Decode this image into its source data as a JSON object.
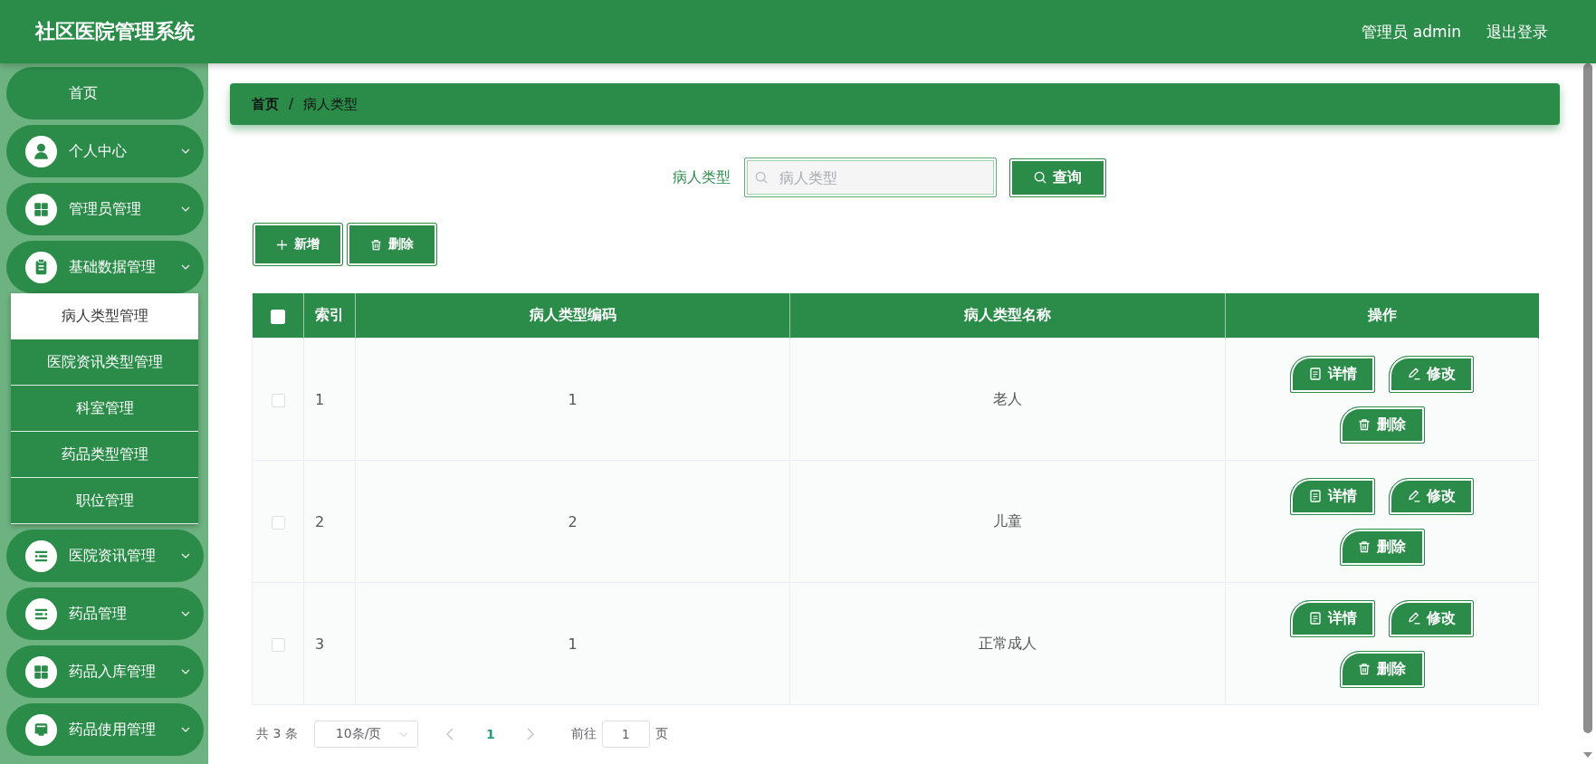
{
  "header": {
    "title": "社区医院管理系统",
    "user": "管理员 admin",
    "logout": "退出登录"
  },
  "sidebar": {
    "items": [
      {
        "kind": "link",
        "label": "首页"
      },
      {
        "kind": "group",
        "label": "个人中心",
        "expanded": false
      },
      {
        "kind": "group",
        "label": "管理员管理",
        "expanded": false
      },
      {
        "kind": "group",
        "label": "基础数据管理",
        "expanded": true,
        "children": [
          {
            "label": "病人类型管理",
            "selected": true
          },
          {
            "label": "医院资讯类型管理",
            "selected": false
          },
          {
            "label": "科室管理",
            "selected": false
          },
          {
            "label": "药品类型管理",
            "selected": false
          },
          {
            "label": "职位管理",
            "selected": false
          }
        ]
      },
      {
        "kind": "group",
        "label": "医院资讯管理",
        "expanded": false
      },
      {
        "kind": "group",
        "label": "药品管理",
        "expanded": false
      },
      {
        "kind": "group",
        "label": "药品入库管理",
        "expanded": false
      },
      {
        "kind": "group",
        "label": "药品使用管理",
        "expanded": false
      }
    ]
  },
  "breadcrumb": {
    "items": [
      "首页",
      "病人类型"
    ],
    "separator": "/"
  },
  "search": {
    "label": "病人类型",
    "placeholder": "病人类型",
    "button": "查询"
  },
  "toolbar": [
    {
      "kind": "add",
      "label": "新增"
    },
    {
      "kind": "delete",
      "label": "删除"
    }
  ],
  "table": {
    "select_all": {
      "checked": false
    },
    "columns": [
      "索引",
      "病人类型编码",
      "病人类型名称",
      "操作"
    ],
    "rows": [
      {
        "checked": false,
        "cells": [
          "1",
          "1",
          "老人"
        ],
        "actions": [
          {
            "kind": "detail",
            "label": "详情"
          },
          {
            "kind": "edit",
            "label": "修改"
          },
          {
            "kind": "delete",
            "label": "删除"
          }
        ]
      },
      {
        "checked": false,
        "cells": [
          "2",
          "2",
          "儿童"
        ],
        "actions": [
          {
            "kind": "detail",
            "label": "详情"
          },
          {
            "kind": "edit",
            "label": "修改"
          },
          {
            "kind": "delete",
            "label": "删除"
          }
        ]
      },
      {
        "checked": false,
        "cells": [
          "3",
          "1",
          "正常成人"
        ],
        "actions": [
          {
            "kind": "detail",
            "label": "详情"
          },
          {
            "kind": "edit",
            "label": "修改"
          },
          {
            "kind": "delete",
            "label": "删除"
          }
        ]
      }
    ]
  },
  "pagination": {
    "total": "共 3 条",
    "page_size": "10条/页",
    "prev": {
      "disabled": true
    },
    "pages": [
      {
        "label": "1",
        "selected": true
      }
    ],
    "next": {
      "disabled": true
    },
    "goto": {
      "label": "前往",
      "value": "1",
      "suffix": "页"
    }
  }
}
